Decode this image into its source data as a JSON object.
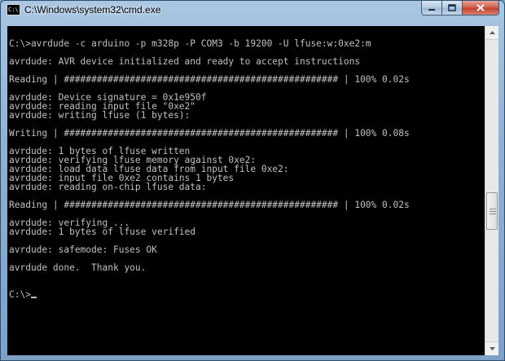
{
  "window": {
    "title": "C:\\Windows\\system32\\cmd.exe",
    "icon": "cmd-icon",
    "icon_text": "C:\\.",
    "controls": {
      "minimize": "minimize-icon",
      "maximize": "maximize-icon",
      "close": "close-icon"
    }
  },
  "console": {
    "lines": [
      "C:\\>avrdude -c arduino -p m328p -P COM3 -b 19200 -U lfuse:w:0xe2:m",
      "",
      "avrdude: AVR device initialized and ready to accept instructions",
      "",
      "Reading | ################################################## | 100% 0.02s",
      "",
      "avrdude: Device signature = 0x1e950f",
      "avrdude: reading input file \"0xe2\"",
      "avrdude: writing lfuse (1 bytes):",
      "",
      "Writing | ################################################## | 100% 0.08s",
      "",
      "avrdude: 1 bytes of lfuse written",
      "avrdude: verifying lfuse memory against 0xe2:",
      "avrdude: load data lfuse data from input file 0xe2:",
      "avrdude: input file 0xe2 contains 1 bytes",
      "avrdude: reading on-chip lfuse data:",
      "",
      "Reading | ################################################## | 100% 0.02s",
      "",
      "avrdude: verifying ...",
      "avrdude: 1 bytes of lfuse verified",
      "",
      "avrdude: safemode: Fuses OK",
      "",
      "avrdude done.  Thank you.",
      "",
      "",
      "C:\\>"
    ]
  },
  "colors": {
    "console_background": "#000000",
    "console_text": "#c0c0c0",
    "close_button": "#c2412c"
  }
}
